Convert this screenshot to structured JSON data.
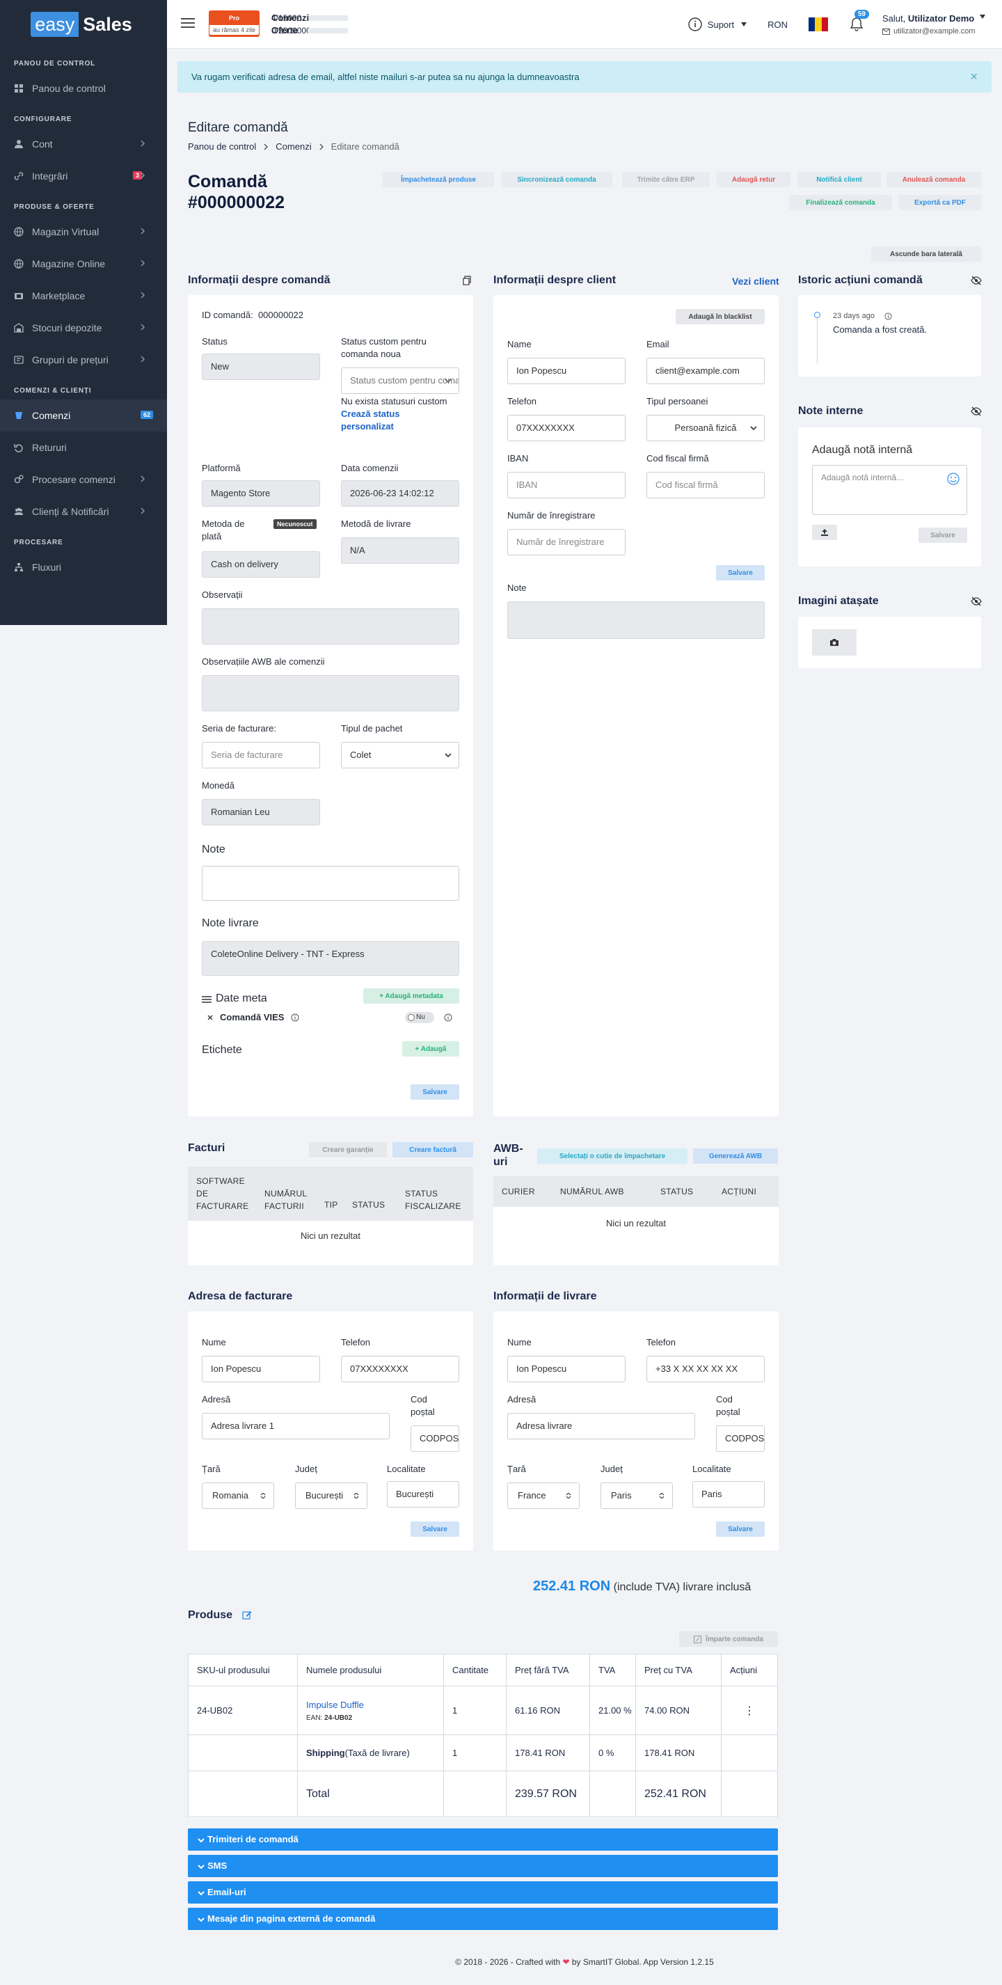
{
  "logo": {
    "part1": "easy",
    "part2": "Sales"
  },
  "sidebar": {
    "sections": [
      {
        "title": "PANOU DE CONTROL"
      },
      {
        "title": "CONFIGURARE"
      },
      {
        "title": "PRODUSE & OFERTE"
      },
      {
        "title": "COMENZI & CLIENȚI"
      },
      {
        "title": "PROCESARE"
      }
    ],
    "items": [
      {
        "label": "Panou de control",
        "icon": "dashboard-icon"
      },
      {
        "label": "Cont",
        "icon": "user-icon"
      },
      {
        "label": "Integrări",
        "icon": "link-icon",
        "badge": "3"
      },
      {
        "label": "Magazin Virtual",
        "icon": "globe-icon"
      },
      {
        "label": "Magazine Online",
        "icon": "globe-icon"
      },
      {
        "label": "Marketplace",
        "icon": "marketplace-icon"
      },
      {
        "label": "Stocuri depozite",
        "icon": "warehouse-icon"
      },
      {
        "label": "Grupuri de prețuri",
        "icon": "price-icon"
      },
      {
        "label": "Comenzi",
        "icon": "orders-icon",
        "badge": "62"
      },
      {
        "label": "Retururi",
        "icon": "return-icon"
      },
      {
        "label": "Procesare comenzi",
        "icon": "gears-icon"
      },
      {
        "label": "Clienți & Notificări",
        "icon": "users-icon"
      },
      {
        "label": "Fluxuri",
        "icon": "flow-icon"
      }
    ]
  },
  "topbar": {
    "plan_label": "Pro",
    "plan_remaining": "au rămas 4 zile",
    "orders_label": "Comenzi",
    "orders_value": "4/15000",
    "offers_label": "Oferte",
    "offers_value": "0/2000000",
    "support_label": "Suport",
    "currency": "RON",
    "notifications": "59",
    "greeting": "Salut,",
    "user_name": "Utilizator Demo",
    "user_email": "utilizator@example.com"
  },
  "alert": {
    "text": "Va rugam verificati adresa de email, altfel niste mailuri s-ar putea sa nu ajunga la dumneavoastra",
    "close": "×"
  },
  "page": {
    "title": "Editare comandă",
    "breadcrumb": [
      "Panou de control",
      "Comenzi",
      "Editare comandă"
    ],
    "order_title_line1": "Comandă",
    "order_title_line2": "#000000022"
  },
  "actions": {
    "pack": "Împachetează produse",
    "sync": "Sincronizează comanda",
    "erp": "Trimite către ERP",
    "return": "Adaugă retur",
    "notify": "Notifică client",
    "cancel": "Anulează comanda",
    "finalize": "Finalizează comanda",
    "export": "Exportă ca PDF",
    "hide_sidebar": "Ascunde bara laterală"
  },
  "order_info": {
    "title": "Informații despre comandă",
    "id_label": "ID comandă:",
    "id_value": "000000022",
    "status_label": "Status",
    "status_value": "New",
    "custom_status_label": "Status custom pentru comanda noua",
    "custom_status_placeholder": "Status custom pentru comanda noua",
    "no_status_text": "Nu exista statusuri custom",
    "create_status_link": "Crează status personalizat",
    "platform_label": "Platformă",
    "platform_value": "Magento Store",
    "date_label": "Data comenzii",
    "date_value": "2026-06-23 14:02:12",
    "payment_label": "Metoda de plată",
    "payment_badge": "Necunoscut",
    "payment_value": "Cash on delivery",
    "shipping_label": "Metodă de livrare",
    "shipping_value": "N/A",
    "observations_label": "Observații",
    "awb_obs_label": "Observațiile AWB ale comenzii",
    "invoice_series_label": "Seria de facturare:",
    "invoice_series_placeholder": "Seria de facturare",
    "package_type_label": "Tipul de pachet",
    "package_type_value": "Colet",
    "currency_label": "Monedă",
    "currency_value": "Romanian Leu",
    "notes_label": "Note",
    "delivery_notes_label": "Note livrare",
    "delivery_notes_value": "ColeteOnline Delivery - TNT - Express",
    "meta_label": "Date meta",
    "add_meta": "+ Adaugă metadata",
    "vies_label": "Comandă VIES",
    "vies_value": "Nu",
    "tags_label": "Etichete",
    "add_tag": "+ Adaugă",
    "save": "Salvare"
  },
  "client_info": {
    "title": "Informații despre client",
    "view_link": "Vezi client",
    "blacklist": "Adaugă în blacklist",
    "name_label": "Name",
    "name_value": "Ion Popescu",
    "email_label": "Email",
    "email_value": "client@example.com",
    "phone_label": "Telefon",
    "phone_value": "07XXXXXXXX",
    "person_type_label": "Tipul persoanei",
    "person_type_value": "Persoană fizică",
    "iban_label": "IBAN",
    "iban_placeholder": "IBAN",
    "fiscal_label": "Cod fiscal firmă",
    "fiscal_placeholder": "Cod fiscal firmă",
    "reg_label": "Număr de înregistrare",
    "reg_placeholder": "Număr de înregistrare",
    "save": "Salvare",
    "notes_label": "Note"
  },
  "history": {
    "title": "Istoric acțiuni comandă",
    "time": "23 days ago",
    "text": "Comanda a fost creată."
  },
  "internal_notes": {
    "title": "Note interne",
    "add_label": "Adaugă notă internă",
    "placeholder": "Adaugă notă internă...",
    "save": "Salvare"
  },
  "images": {
    "title": "Imagini atașate"
  },
  "invoices": {
    "title": "Facturi",
    "create_warranty": "Creare garanție",
    "create_invoice": "Creare factură",
    "columns": [
      "SOFTWARE DE FACTURARE",
      "NUMĂRUL FACTURII",
      "TIP",
      "STATUS",
      "STATUS FISCALIZARE"
    ],
    "empty": "Nici un rezultat"
  },
  "awb": {
    "title": "AWB-uri",
    "select_boxes": "Selectați o cutie de împachetare",
    "generate": "Generează AWB",
    "columns": [
      "CURIER",
      "NUMĂRUL AWB",
      "STATUS",
      "ACȚIUNI"
    ],
    "empty": "Nici un rezultat"
  },
  "billing": {
    "title": "Adresa de facturare",
    "name_label": "Nume",
    "name_value": "Ion Popescu",
    "phone_label": "Telefon",
    "phone_value": "07XXXXXXXX",
    "address_label": "Adresă",
    "address_value": "Adresa livrare 1",
    "zip_label": "Cod poștal",
    "zip_value": "CODPOSTAL",
    "country_label": "Țară",
    "country_value": "Romania",
    "county_label": "Județ",
    "county_value": "București",
    "city_label": "Localitate",
    "city_value": "București",
    "save": "Salvare"
  },
  "delivery": {
    "title": "Informații de livrare",
    "name_label": "Nume",
    "name_value": "Ion Popescu",
    "phone_label": "Telefon",
    "phone_value": "+33 X XX XX XX XX",
    "address_label": "Adresă",
    "address_value": "Adresa livrare",
    "zip_label": "Cod poștal",
    "zip_value": "CODPOSTAL",
    "country_label": "Țară",
    "country_value": "France",
    "county_label": "Județ",
    "county_value": "Paris",
    "city_label": "Localitate",
    "city_value": "Paris",
    "save": "Salvare"
  },
  "total": {
    "amount": "252.41 RON",
    "note": "(include TVA) livrare inclusă"
  },
  "products": {
    "title": "Produse",
    "split": "Împarte comanda",
    "columns": [
      "SKU-ul produsului",
      "Numele produsului",
      "Cantitate",
      "Preț fără TVA",
      "TVA",
      "Preț cu TVA",
      "Acțiuni"
    ],
    "row1": {
      "sku": "24-UB02",
      "name": "Impulse Duffle",
      "ean_label": "EAN:",
      "ean": "24-UB02",
      "qty": "1",
      "net": "61.16 RON",
      "vat": "21.00 %",
      "gross": "74.00 RON",
      "menu": "⋮"
    },
    "row2": {
      "name": "Shipping",
      "sub": "(Taxă de livrare)",
      "qty": "1",
      "net": "178.41 RON",
      "vat": "0 %",
      "gross": "178.41 RON"
    },
    "total_label": "Total",
    "total_net": "239.57 RON",
    "total_gross": "252.41 RON"
  },
  "accordions": [
    "Trimiteri de comandă",
    "SMS",
    "Email-uri",
    "Mesaje din pagina externă de comandă"
  ],
  "footer": {
    "text1": "© 2018 - 2026 - Crafted with",
    "text2": "by SmartIT Global. App Version 1.2.15"
  },
  "colors": {
    "sidebar": "#222b3a",
    "accent": "#2f8fe6",
    "accordion": "#1f8ff2",
    "plan": "#e9501e"
  }
}
